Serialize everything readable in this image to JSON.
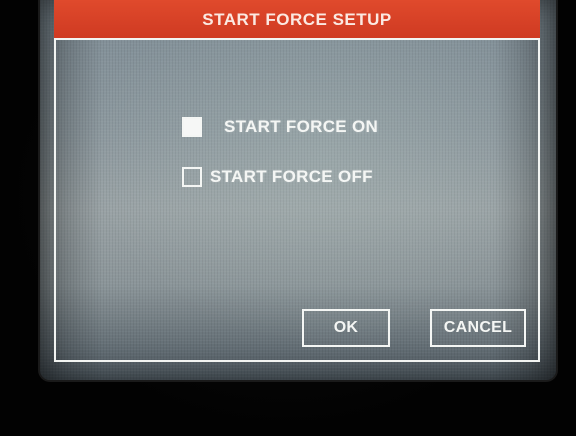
{
  "dialog": {
    "title": "START FORCE SETUP",
    "title_color": "#d9412a"
  },
  "options": [
    {
      "label": "START FORCE ON",
      "checked": true
    },
    {
      "label": "START FORCE OFF",
      "checked": false
    }
  ],
  "buttons": {
    "ok_label": "OK",
    "cancel_label": "CANCEL"
  }
}
